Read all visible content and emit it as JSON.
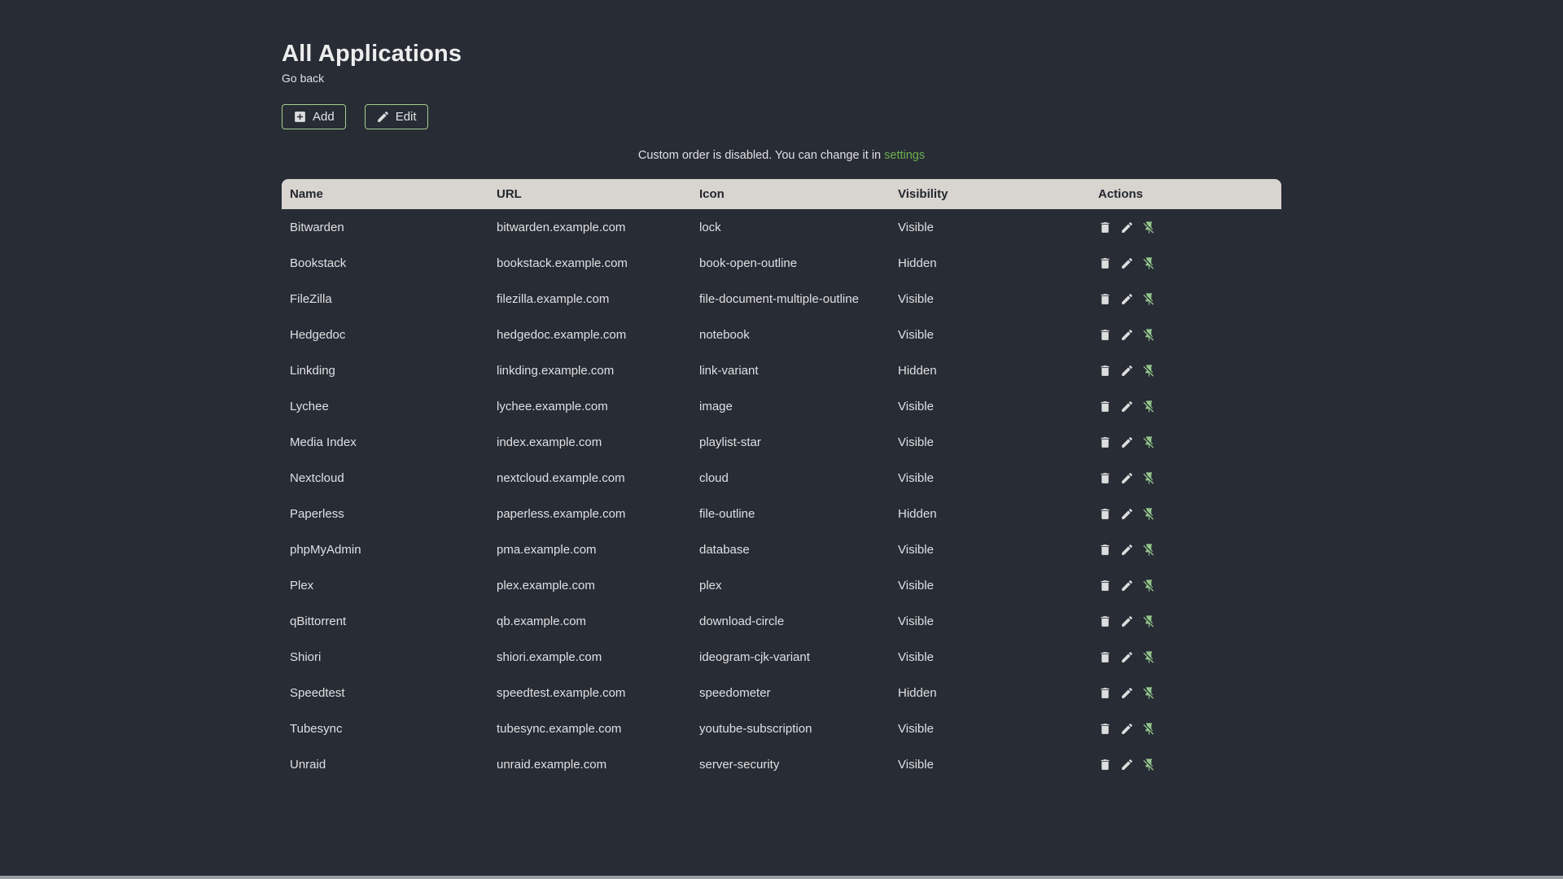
{
  "page": {
    "title": "All Applications",
    "back_link": "Go back",
    "note_text": "Custom order is disabled. You can change it in",
    "note_link": "settings"
  },
  "toolbar": {
    "add_label": "Add",
    "edit_label": "Edit"
  },
  "table": {
    "columns": [
      "Name",
      "URL",
      "Icon",
      "Visibility",
      "Actions"
    ],
    "rows": [
      {
        "name": "Bitwarden",
        "url": "bitwarden.example.com",
        "icon": "lock",
        "visibility": "Visible"
      },
      {
        "name": "Bookstack",
        "url": "bookstack.example.com",
        "icon": "book-open-outline",
        "visibility": "Hidden"
      },
      {
        "name": "FileZilla",
        "url": "filezilla.example.com",
        "icon": "file-document-multiple-outline",
        "visibility": "Visible"
      },
      {
        "name": "Hedgedoc",
        "url": "hedgedoc.example.com",
        "icon": "notebook",
        "visibility": "Visible"
      },
      {
        "name": "Linkding",
        "url": "linkding.example.com",
        "icon": "link-variant",
        "visibility": "Hidden"
      },
      {
        "name": "Lychee",
        "url": "lychee.example.com",
        "icon": "image",
        "visibility": "Visible"
      },
      {
        "name": "Media Index",
        "url": "index.example.com",
        "icon": "playlist-star",
        "visibility": "Visible"
      },
      {
        "name": "Nextcloud",
        "url": "nextcloud.example.com",
        "icon": "cloud",
        "visibility": "Visible"
      },
      {
        "name": "Paperless",
        "url": "paperless.example.com",
        "icon": "file-outline",
        "visibility": "Hidden"
      },
      {
        "name": "phpMyAdmin",
        "url": "pma.example.com",
        "icon": "database",
        "visibility": "Visible"
      },
      {
        "name": "Plex",
        "url": "plex.example.com",
        "icon": "plex",
        "visibility": "Visible"
      },
      {
        "name": "qBittorrent",
        "url": "qb.example.com",
        "icon": "download-circle",
        "visibility": "Visible"
      },
      {
        "name": "Shiori",
        "url": "shiori.example.com",
        "icon": "ideogram-cjk-variant",
        "visibility": "Visible"
      },
      {
        "name": "Speedtest",
        "url": "speedtest.example.com",
        "icon": "speedometer",
        "visibility": "Hidden"
      },
      {
        "name": "Tubesync",
        "url": "tubesync.example.com",
        "icon": "youtube-subscription",
        "visibility": "Visible"
      },
      {
        "name": "Unraid",
        "url": "unraid.example.com",
        "icon": "server-security",
        "visibility": "Visible"
      }
    ],
    "row_actions": [
      "delete-icon",
      "edit-icon",
      "unpin-icon"
    ]
  },
  "colors": {
    "background": "#272c35",
    "text": "#e0e1e3",
    "header_bg": "#d8d4cf",
    "header_text": "#23272e",
    "accent_green": "#6cb14f",
    "button_border": "#a5cf90",
    "pin_green": "#95c68c"
  }
}
